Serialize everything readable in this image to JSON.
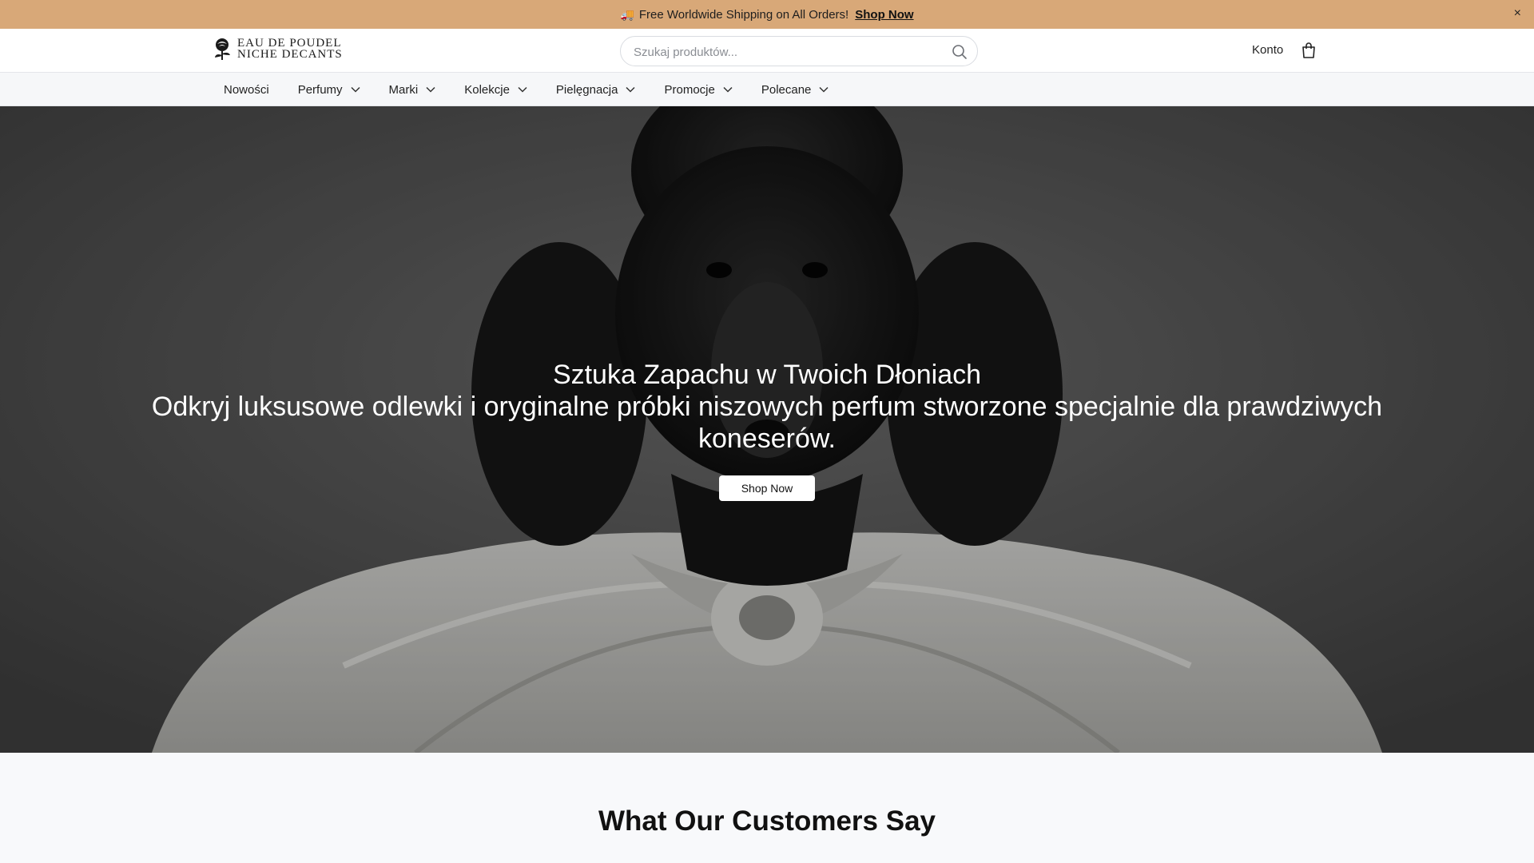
{
  "announcement": {
    "icon": "truck-icon",
    "text": "Free Worldwide Shipping on All Orders!",
    "link_label": "Shop Now",
    "close_label": "×"
  },
  "header": {
    "logo_line1": "EAU DE POUDEL",
    "logo_line2": "NICHE DECANTS",
    "search_placeholder": "Szukaj produktów...",
    "search_icon": "search-icon",
    "account_label": "Konto",
    "cart_icon": "shopping-bag-icon"
  },
  "nav": {
    "items": [
      {
        "label": "Nowości",
        "dropdown": false
      },
      {
        "label": "Perfumy",
        "dropdown": true
      },
      {
        "label": "Marki",
        "dropdown": true
      },
      {
        "label": "Kolekcje",
        "dropdown": true
      },
      {
        "label": "Pielęgnacja",
        "dropdown": true
      },
      {
        "label": "Promocje",
        "dropdown": true
      },
      {
        "label": "Polecane",
        "dropdown": true
      }
    ]
  },
  "hero": {
    "title": "Sztuka Zapachu w Twoich Dłoniach",
    "subtitle": "Odkryj luksusowe odlewki i oryginalne próbki niszowych perfum stworzone specjalnie dla prawdziwych koneserów.",
    "button_label": "Shop Now"
  },
  "testimonials": {
    "heading": "What Our Customers Say"
  },
  "colors": {
    "announcement_bg": "#d8a878",
    "header_bg": "#ffffff",
    "nav_bg": "#f6f7f9",
    "page_bg": "#f8f9fb"
  }
}
